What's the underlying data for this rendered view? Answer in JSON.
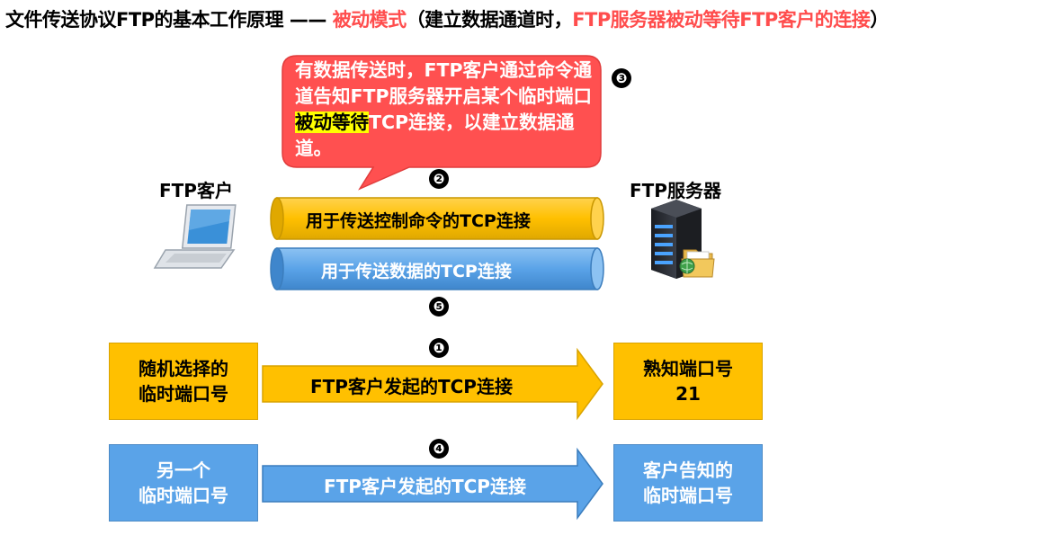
{
  "title": {
    "part1": "文件传送协议FTP的基本工作原理",
    "dash": "——",
    "mode": "被动模式",
    "part2": "（建立数据通道时，",
    "server_waits": "FTP服务器被动等待FTP客户的连接",
    "part3": "）"
  },
  "bubble": {
    "text_before": "有数据传送时，FTP客户通过命令通道告知FTP服务器开启某个临时端口",
    "highlight": "被动等待",
    "text_after": "TCP连接，以建立数据通道。"
  },
  "labels": {
    "client": "FTP客户",
    "server": "FTP服务器"
  },
  "steps": {
    "s1": "❶",
    "s2": "❷",
    "s3": "❸",
    "s4": "❹",
    "s5": "❺"
  },
  "pipes": {
    "control": "用于传送控制命令的TCP连接",
    "data": "用于传送数据的TCP连接"
  },
  "row1": {
    "left": "随机选择的\n临时端口号",
    "arrow": "FTP客户发起的TCP连接",
    "right": "熟知端口号\n21"
  },
  "row2": {
    "left": "另一个\n临时端口号",
    "arrow": "FTP客户发起的TCP连接",
    "right": "客户告知的\n临时端口号"
  },
  "colors": {
    "accent_red": "#ff4d4d",
    "orange": "#ffc000",
    "blue": "#5aa3e8",
    "highlight": "#ffff00"
  },
  "icons": {
    "client": "laptop-icon",
    "server": "server-icon"
  }
}
